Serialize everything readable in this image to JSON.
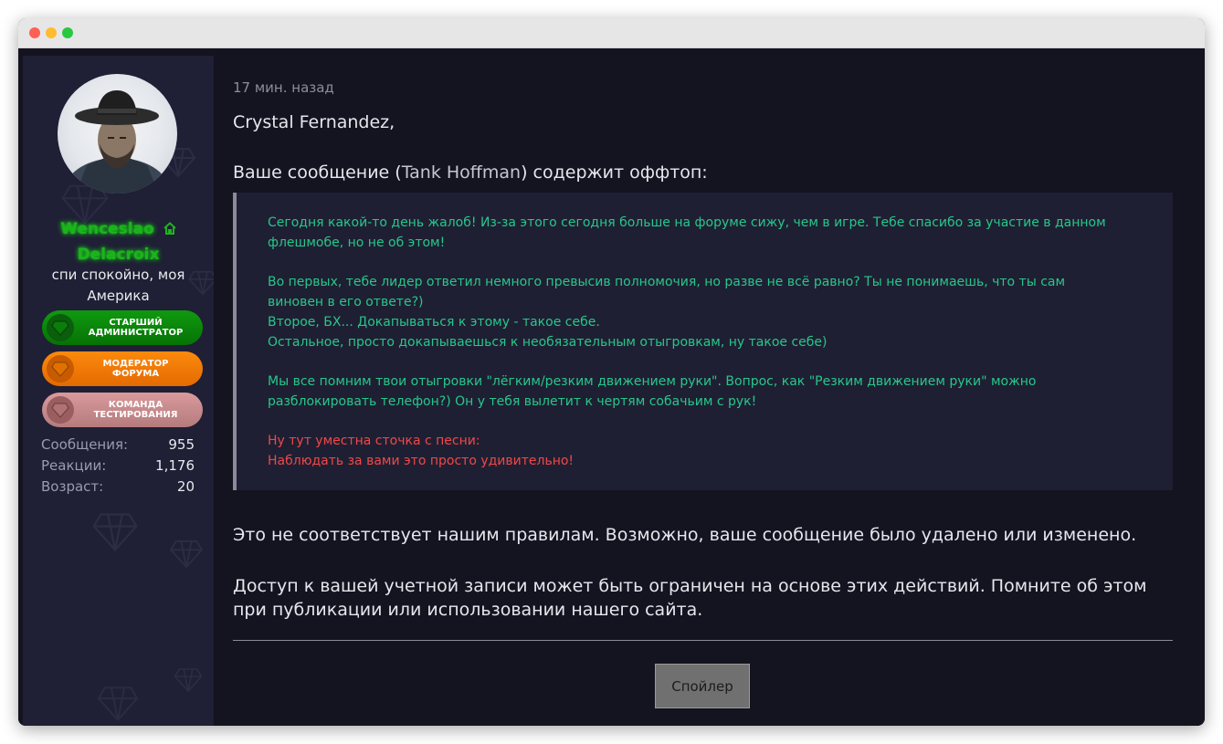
{
  "window": {
    "controls": [
      "close",
      "minimize",
      "maximize"
    ]
  },
  "sidebar": {
    "username_line1": "Wenceslao",
    "username_icon": "house-icon",
    "username_line2": "Delacroix",
    "user_title_line1": "спи спокойно, моя",
    "user_title_line2": "Америка",
    "badges": [
      {
        "line1": "СТАРШИЙ",
        "line2": "АДМИНИСТРАТОР",
        "icon": "gem-icon",
        "color": "#0a8a0a"
      },
      {
        "line1": "МОДЕРАТОР",
        "line2": "ФОРУМА",
        "icon": "gem-icon",
        "color": "#f47c07"
      },
      {
        "line1": "КОМАНДА",
        "line2": "ТЕСТИРОВАНИЯ",
        "icon": "gem-icon",
        "color": "#c98b8d"
      }
    ],
    "stats": [
      {
        "label": "Сообщения:",
        "value": "955"
      },
      {
        "label": "Реакции:",
        "value": "1,176"
      },
      {
        "label": "Возраст:",
        "value": "20"
      }
    ]
  },
  "post": {
    "time": "17 мин. назад",
    "greeting": "Crystal Fernandez,",
    "offtopic_prefix": "Ваше сообщение (",
    "offtopic_author": "Tank Hoffman",
    "offtopic_suffix": ") содержит оффтоп:",
    "quote": {
      "p1": [
        "Сегодня какой-то день жалоб! Из-за этого сегодня больше на форуме сижу, чем в игре. Тебе спасибо за участие в данном",
        "флешмобе, но не об этом!"
      ],
      "p2": [
        "Во первых, тебе лидер ответил немного превысив полномочия, но разве не всё равно? Ты не понимаешь, что ты сам",
        "виновен в его ответе?)",
        "Второе, БХ... Докапываться к этому - такое себе.",
        "Остальное, просто докапываешься к необязательным отыгровкам, ну такое себе)"
      ],
      "p3": [
        "Мы все помним твои отыгровки \"лёгким/резким движением руки\". Вопрос, как \"Резким движением руки\" можно",
        "разблокировать телефон?) Он у тебя вылетит к чертям собачьим с рук!"
      ],
      "p4": [
        "Ну тут уместна сточка с песни:",
        "Наблюдать за вами это просто удивительно!"
      ]
    },
    "rules_text": "Это не соответствует нашим правилам. Возможно, ваше сообщение было удалено или изменено.",
    "access_line1": "Доступ к вашей учетной записи может быть ограничен на основе этих действий. Помните об этом",
    "access_line2": "при публикации или использовании нашего сайта.",
    "spoiler_label": "Спойлер"
  },
  "colors": {
    "quote_text": "#27c78a",
    "quote_highlight": "#f04848",
    "username": "#1db31d",
    "background": "#141320",
    "sidebar": "#1f1f35"
  }
}
